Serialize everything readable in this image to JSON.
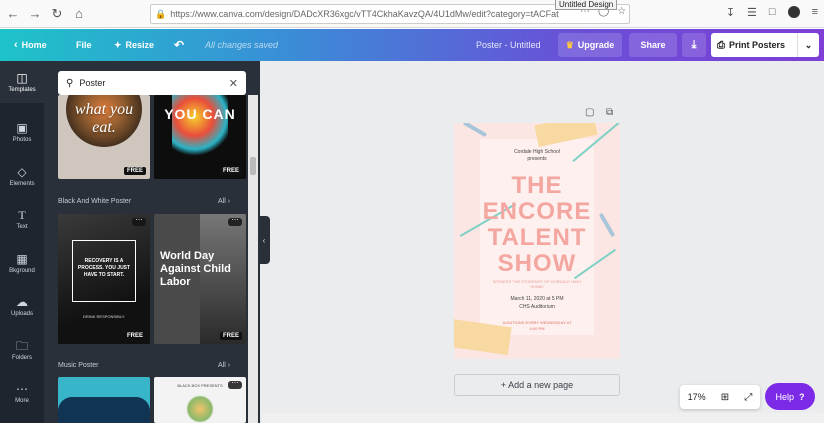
{
  "browser": {
    "url": "https://www.canva.com/design/DADcXR36xgc/vTT4CkhaKavzQA/4U1dMw/edit?category=tACFat",
    "tooltip": "Untitled Design"
  },
  "topbar": {
    "home_label": "Home",
    "file_label": "File",
    "resize_label": "Resize",
    "saved_status": "All changes saved",
    "design_title": "Poster - Untitled",
    "upgrade_label": "Upgrade",
    "share_label": "Share",
    "print_label": "Print Posters"
  },
  "sidebar": {
    "items": [
      {
        "label": "Templates",
        "icon": "template-icon"
      },
      {
        "label": "Photos",
        "icon": "photo-icon"
      },
      {
        "label": "Elements",
        "icon": "elements-icon"
      },
      {
        "label": "Text",
        "icon": "text-icon"
      },
      {
        "label": "Bkground",
        "icon": "background-icon"
      },
      {
        "label": "Uploads",
        "icon": "upload-icon"
      },
      {
        "label": "Folders",
        "icon": "folder-icon"
      },
      {
        "label": "More",
        "icon": "more-icon"
      }
    ]
  },
  "panel": {
    "search_value": "Poster",
    "thumb1_text": "what you eat.",
    "thumb2_text": "YOU CAN",
    "section_bw": "Black And White Poster",
    "section_bw_all": "All",
    "thumb3_text": "RECOVERY IS A PROCESS. YOU JUST HAVE TO START.",
    "thumb3_sub": "DRINK RESPONSIBLY.",
    "thumb4_text": "World Day Against Child Labor",
    "section_music": "Music Poster",
    "section_music_all": "All",
    "thumb6_text": "BLACK BOX PRESENTS",
    "free_label": "FREE"
  },
  "poster": {
    "school": "Cordale High School",
    "presents": "presents",
    "title_line1": "THE",
    "title_line2": "ENCORE",
    "title_line3": "TALENT",
    "title_line4": "SHOW",
    "witness": "WITNESS THE STUDENTS OF CORDALE HIGH SHINE!",
    "date": "March 11, 2020 at 5 PM",
    "venue": "CHS Auditorium",
    "auditions": "AUDITIONS EVERY WEDNESDAY AT 4:00 PM"
  },
  "canvas": {
    "add_page_label": "+ Add a new page",
    "zoom_label": "17%",
    "help_label": "Help",
    "help_icon": "?"
  },
  "colors": {
    "accent_purple": "#7d2ae8",
    "sidebar_bg": "#1e252f",
    "panel_bg": "#293039",
    "poster_bg": "#fbe6e3",
    "poster_title": "#f4a6a0"
  }
}
